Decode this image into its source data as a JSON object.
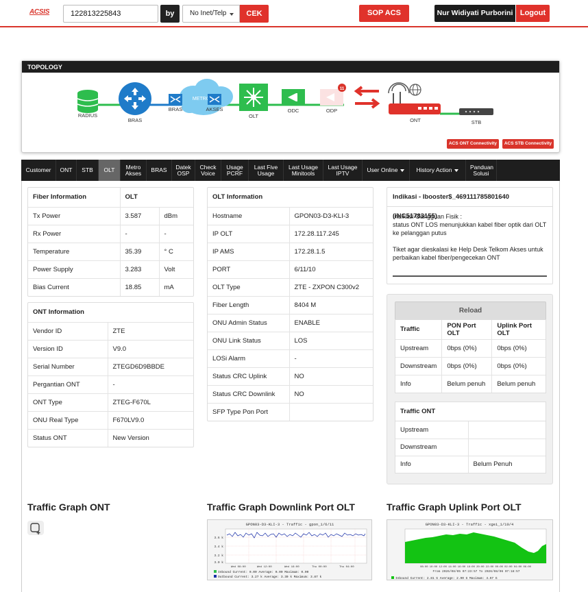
{
  "header": {
    "logo": "ACSIS",
    "search_value": "122813225843",
    "by_label": "by",
    "search_type": "No Inet/Telp",
    "cek_label": "CEK",
    "sop_label": "SOP ACS",
    "user_name": "Nur Widiyati Purborini",
    "logout_label": "Logout"
  },
  "topology": {
    "title": "TOPOLOGY",
    "nodes": {
      "radius": "RADIUS",
      "bras": "BRAS",
      "metro": "METRO - E",
      "bras2": "BRAS",
      "akses": "AKSES",
      "olt": "OLT",
      "odc": "ODC",
      "odp": "ODP",
      "odp_badge": "11",
      "ont": "ONT",
      "stb": "STB"
    },
    "acs_ont": "ACS ONT Connectivity",
    "acs_stb": "ACS STB Connectivity"
  },
  "tabs": [
    {
      "label": "Customer"
    },
    {
      "label": "ONT"
    },
    {
      "label": "STB"
    },
    {
      "label": "OLT",
      "active": true
    },
    {
      "label": "Metro Akses"
    },
    {
      "label": "BRAS"
    },
    {
      "label": "Datek OSP"
    },
    {
      "label": "Check Voice"
    },
    {
      "label": "Usage PCRF"
    },
    {
      "label": "Last Five Usage"
    },
    {
      "label": "Last Usage Minitools"
    },
    {
      "label": "Last Usage IPTV"
    },
    {
      "label": "User Online",
      "dropdown": true
    },
    {
      "label": "History Action",
      "dropdown": true
    },
    {
      "label": "Panduan Solusi"
    }
  ],
  "fiber": {
    "title": "Fiber Information",
    "col": "OLT",
    "rows": [
      [
        "Tx Power",
        "3.587",
        "dBm"
      ],
      [
        "Rx Power",
        "-",
        "-"
      ],
      [
        "Temperature",
        "35.39",
        "° C"
      ],
      [
        "Power Supply",
        "3.283",
        "Volt"
      ],
      [
        "Bias Current",
        "18.85",
        "mA"
      ]
    ]
  },
  "ont": {
    "title": "ONT Information",
    "rows": [
      [
        "Vendor ID",
        "ZTE"
      ],
      [
        "Version ID",
        "V9.0"
      ],
      [
        "Serial Number",
        "ZTEGD6D9BBDE"
      ],
      [
        "Pergantian ONT",
        "-"
      ],
      [
        "ONT Type",
        "ZTEG-F670L"
      ],
      [
        "ONU Real Type",
        "F670LV9.0"
      ],
      [
        "Status ONT",
        "New Version"
      ]
    ]
  },
  "olt": {
    "title": "OLT Information",
    "rows": [
      [
        "Hostname",
        "GPON03-D3-KLI-3"
      ],
      [
        "IP OLT",
        "172.28.117.245"
      ],
      [
        "IP AMS",
        "172.28.1.5"
      ],
      [
        "PORT",
        "6/11/10"
      ],
      [
        "OLT Type",
        "ZTE - ZXPON C300v2"
      ],
      [
        "Fiber Length",
        "8404 M"
      ],
      [
        "ONU Admin Status",
        "ENABLE"
      ],
      [
        "ONU Link Status",
        "LOS"
      ],
      [
        "LOSi Alarm",
        "-"
      ],
      [
        "Status CRC Uplink",
        "NO"
      ],
      [
        "Status CRC Downlink",
        "NO"
      ],
      [
        "SFP Type Pon Port",
        ""
      ]
    ]
  },
  "indikasi": {
    "title": "Indikasi - Ibooster$_469111785801640 (INC51783155)",
    "line1": "Indikasi Gangguan Fisik :",
    "line2": "status ONT LOS menunjukkan kabel fiber optik dari OLT ke pelanggan putus",
    "line3": "Tiket agar dieskalasi ke Help Desk Telkom Akses untuk perbaikan kabel fiber/pengecekan ONT"
  },
  "traffic": {
    "reload": "Reload",
    "headers": [
      "Traffic",
      "PON Port OLT",
      "Uplink Port OLT"
    ],
    "rows": [
      [
        "Upstream",
        "0bps (0%)",
        "0bps (0%)"
      ],
      [
        "Downstream",
        "0bps (0%)",
        "0bps (0%)"
      ],
      [
        "Info",
        "Belum penuh",
        "Belum penuh"
      ]
    ]
  },
  "traffic_ont": {
    "title": "Traffic ONT",
    "rows": [
      [
        "Upstream",
        ""
      ],
      [
        "Downstream",
        ""
      ],
      [
        "Info",
        "Belum Penuh"
      ]
    ]
  },
  "graphs": {
    "ont_title": "Traffic Graph ONT",
    "downlink_title": "Traffic Graph Downlink Port OLT",
    "uplink_title": "Traffic Graph Uplink Port OLT",
    "downlink_img_title": "GPON03-D3-KLI-3 - Traffic - gpon_1/6/11",
    "uplink_img_title": "GPON03-D3-KLI-3 - Traffic - xgei_1/10/4",
    "downlink_x": [
      "Wed 08:00",
      "Wed 12:00",
      "Wed 16:00",
      "Thu 00:00",
      "Thu 04:00"
    ],
    "downlink_y": [
      "3.6 k",
      "3.4 k",
      "3.2 k",
      "3.0 k"
    ],
    "downlink_legend": [
      "Inbound    Current:    0.00    Average:    0.00    Maximum:    0.00",
      "Outbound   Current:    3.27 k  Average:    3.30 k  Maximum:    3.87 k"
    ],
    "uplink_x": "08:00 10:00 12:00 14:00 16:00 18:00 20:00 22:00 00:00 02:00 04:00 06:00",
    "uplink_from": "From 2026/08/05 07:23:57 To 2026/08/06 07:18:57",
    "uplink_legend": "Inbound    Current:    2.81 G   Average:    2.90 G   Maximum:    4.67 G"
  }
}
